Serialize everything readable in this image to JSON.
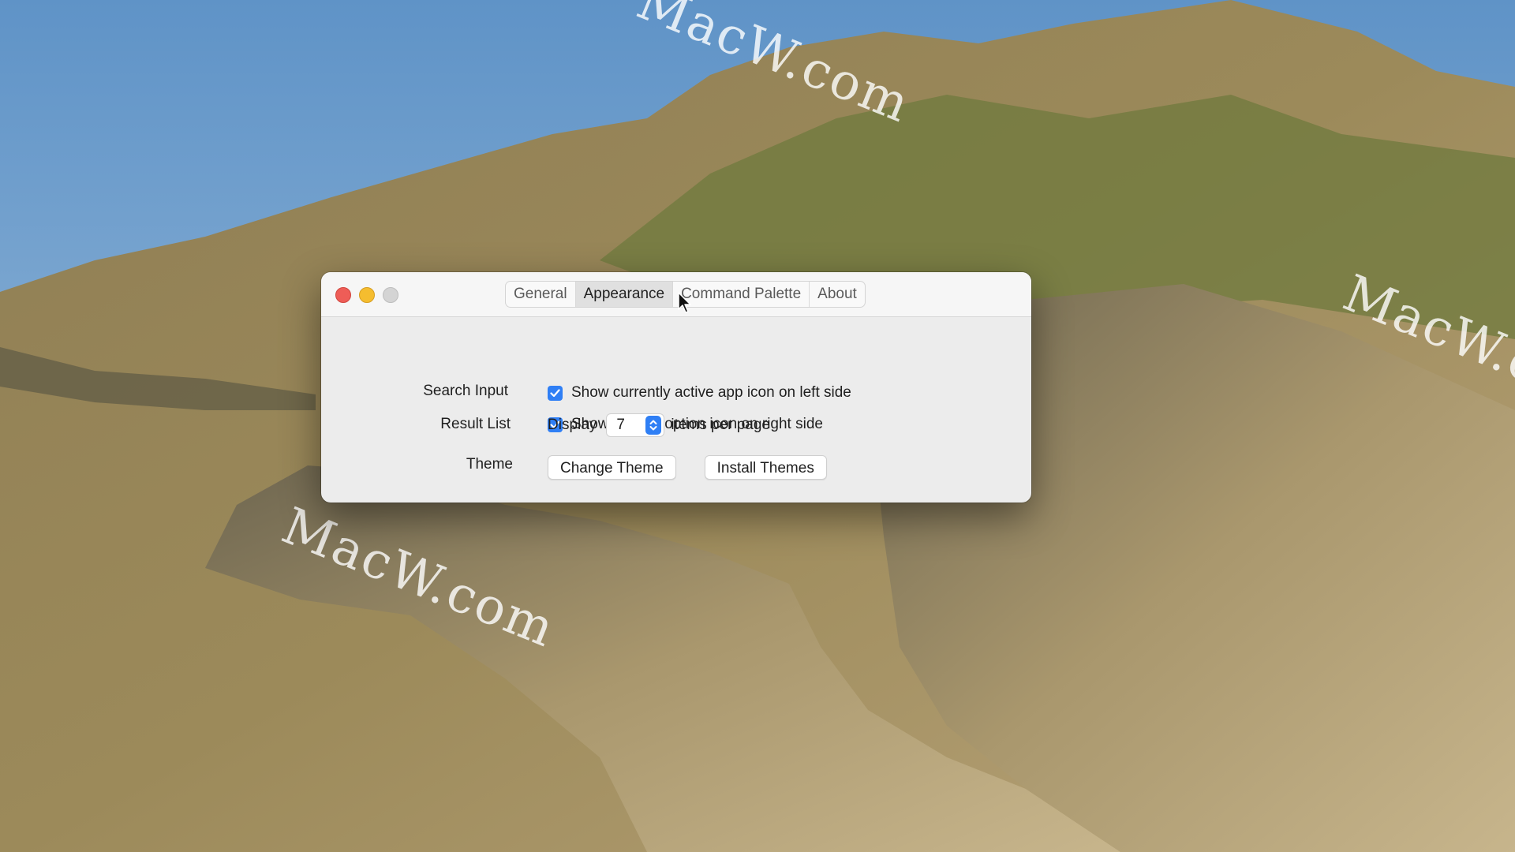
{
  "colors": {
    "accent": "#2f7ff5",
    "close": "#ee5d57",
    "minimize": "#f5bd2f",
    "zoom_disabled": "#d4d4d4"
  },
  "watermarks": [
    "MacW.com",
    "MacW.com",
    "MacW.com"
  ],
  "window": {
    "tabs": [
      {
        "label": "General",
        "active": false
      },
      {
        "label": "Appearance",
        "active": true
      },
      {
        "label": "Command Palette",
        "active": false
      },
      {
        "label": "About",
        "active": false
      }
    ],
    "search_input": {
      "label": "Search Input",
      "options": [
        {
          "label": "Show currently active app icon on left side",
          "checked": true
        },
        {
          "label": "Show Paletro option icon on right side",
          "checked": true
        }
      ]
    },
    "result_list": {
      "label": "Result List",
      "prefix": "Display",
      "value": "7",
      "suffix": "items per page"
    },
    "theme": {
      "label": "Theme",
      "change_button": "Change Theme",
      "install_button": "Install Themes"
    }
  }
}
